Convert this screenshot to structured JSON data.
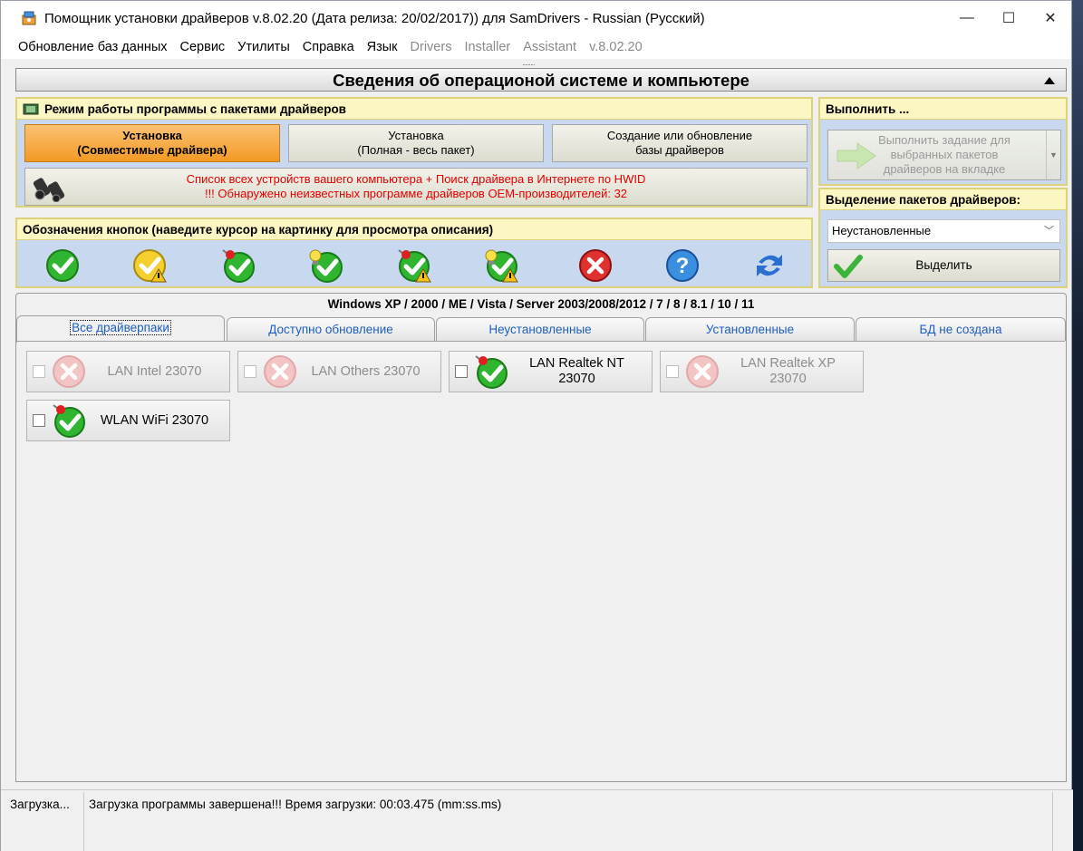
{
  "window": {
    "title": "Помощник установки драйверов v.8.02.20 (Дата релиза: 20/02/2017)) для SamDrivers - Russian (Русский)",
    "controls": {
      "minimize": "—",
      "maximize": "☐",
      "close": "✕"
    }
  },
  "menu": {
    "items": [
      {
        "label": "Обновление баз данных",
        "enabled": true
      },
      {
        "label": "Сервис",
        "enabled": true
      },
      {
        "label": "Утилиты",
        "enabled": true
      },
      {
        "label": "Справка",
        "enabled": true
      },
      {
        "label": "Язык",
        "enabled": true
      },
      {
        "label": "Drivers",
        "enabled": false
      },
      {
        "label": "Installer",
        "enabled": false
      },
      {
        "label": "Assistant",
        "enabled": false
      },
      {
        "label": "v.8.02.20",
        "enabled": false
      }
    ]
  },
  "header": {
    "title": "Сведения об операционой системе и компьютере",
    "handle": "ˑˑˑˑˑˑˑˑˑ"
  },
  "mode_panel": {
    "title": "Режим работы программы с пакетами драйверов",
    "buttons": [
      {
        "line1": "Установка",
        "line2": "(Совместимые драйвера)"
      },
      {
        "line1": "Установка",
        "line2": "(Полная - весь пакет)"
      },
      {
        "line1": "Создание или обновление",
        "line2": "базы драйверов"
      }
    ],
    "devices_button": {
      "line1": "Список всех устройств вашего компьютера + Поиск драйвера в Интернете по HWID",
      "line2": "!!! Обнаружено неизвестных программе драйверов OEM-производителей: 32"
    }
  },
  "execute_panel": {
    "title": "Выполнить ...",
    "button": {
      "line1": "Выполнить задание для",
      "line2": "выбранных пакетов",
      "line3": "драйверов на вкладке"
    }
  },
  "legend_panel": {
    "title": "Обозначения кнопок (наведите курсор на картинку для просмотра описания)",
    "icons": [
      "green-check-icon",
      "yellow-check-warning-icon",
      "pin-check-icon",
      "bulb-check-icon",
      "pin-check-warning-icon",
      "bulb-check-warning-icon",
      "red-x-icon",
      "help-icon",
      "refresh-icon"
    ]
  },
  "select_panel": {
    "title": "Выделение пакетов драйверов:",
    "selected": "Неустановленные",
    "button": "Выделить"
  },
  "os_line": "Windows XP / 2000 / ME / Vista / Server 2003/2008/2012 / 7 / 8 / 8.1 / 10 / 11",
  "tabs": [
    {
      "label": "Все драйверпаки",
      "active": true
    },
    {
      "label": "Доступно обновление",
      "active": false
    },
    {
      "label": "Неустановленные",
      "active": false
    },
    {
      "label": "Установленные",
      "active": false
    },
    {
      "label": "БД не создана",
      "active": false
    }
  ],
  "packs": [
    {
      "line1": "LAN Intel 23070",
      "line2": "",
      "status": "disabled",
      "icon": "red-x-icon"
    },
    {
      "line1": "LAN Others 23070",
      "line2": "",
      "status": "disabled",
      "icon": "red-x-icon"
    },
    {
      "line1": "LAN Realtek NT",
      "line2": "23070",
      "status": "enabled",
      "icon": "pin-check-icon"
    },
    {
      "line1": "LAN Realtek XP",
      "line2": "23070",
      "status": "disabled",
      "icon": "red-x-icon"
    },
    {
      "line1": "WLAN WiFi 23070",
      "line2": "",
      "status": "enabled",
      "icon": "pin-check-icon"
    }
  ],
  "status": {
    "left": "Загрузка...",
    "message": "Загрузка программы завершена!!! Время загрузки: 00:03.475 (mm:ss.ms)"
  },
  "colors": {
    "orange": "#f39a24",
    "panel_blue": "#c8d8ef",
    "panel_head": "#fcf6c2",
    "link_blue": "#1f5fbf",
    "warn_red": "#e60000"
  }
}
